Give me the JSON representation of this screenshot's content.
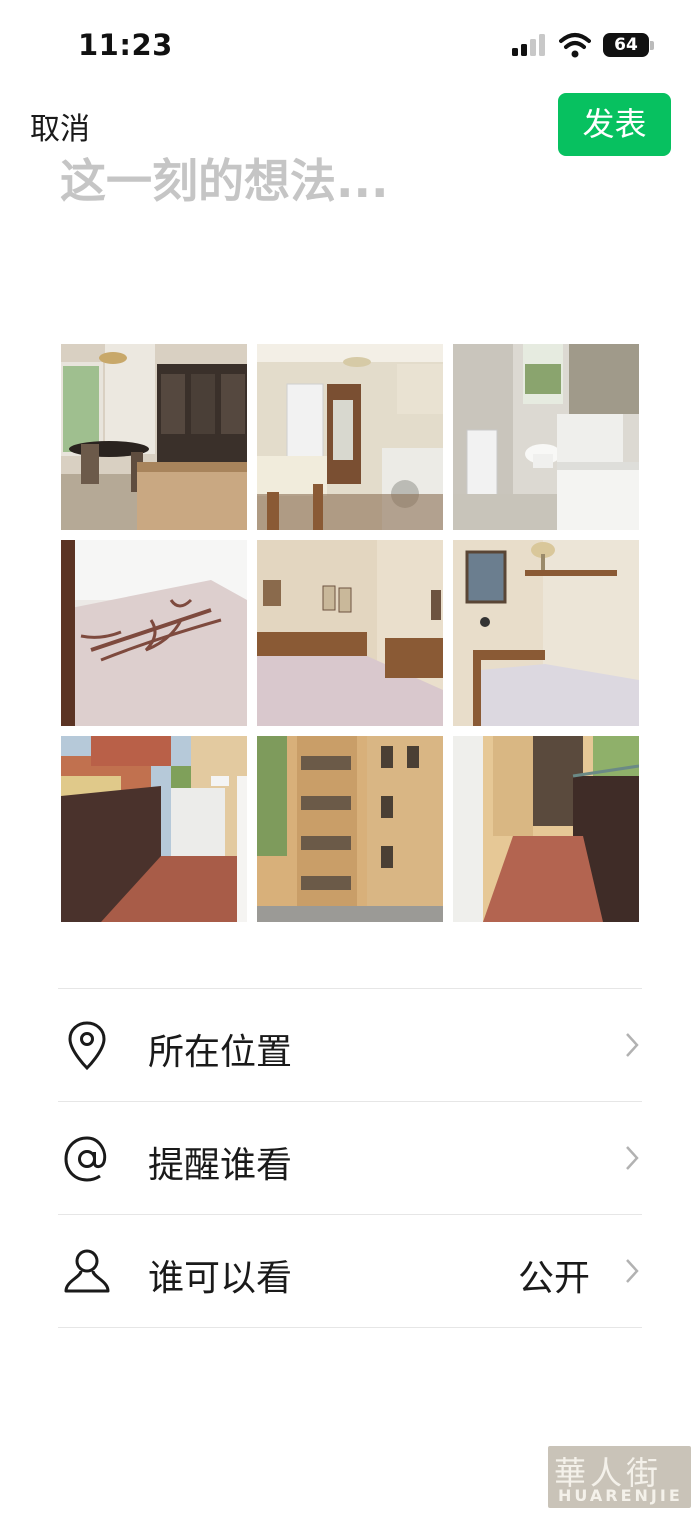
{
  "status_bar": {
    "time": "11:23",
    "battery_level": "64",
    "signal_icon": "cellular-signal-icon",
    "wifi_icon": "wifi-icon"
  },
  "nav": {
    "cancel_label": "取消",
    "publish_label": "发表",
    "publish_color": "#07c160"
  },
  "compose": {
    "placeholder": "这一刻的想法..."
  },
  "photos": [
    {
      "name": "dining-room"
    },
    {
      "name": "kitchen"
    },
    {
      "name": "bathroom"
    },
    {
      "name": "bed-closeup"
    },
    {
      "name": "double-bedroom"
    },
    {
      "name": "single-bedroom"
    },
    {
      "name": "balcony"
    },
    {
      "name": "building-exterior"
    },
    {
      "name": "balcony-corridor"
    }
  ],
  "options": [
    {
      "icon": "location-pin-icon",
      "label": "所在位置",
      "value": ""
    },
    {
      "icon": "at-sign-icon",
      "label": "提醒谁看",
      "value": ""
    },
    {
      "icon": "person-icon",
      "label": "谁可以看",
      "value": "公开"
    }
  ],
  "watermark": {
    "chinese": "華人街",
    "latin": "HUARENJIE"
  }
}
